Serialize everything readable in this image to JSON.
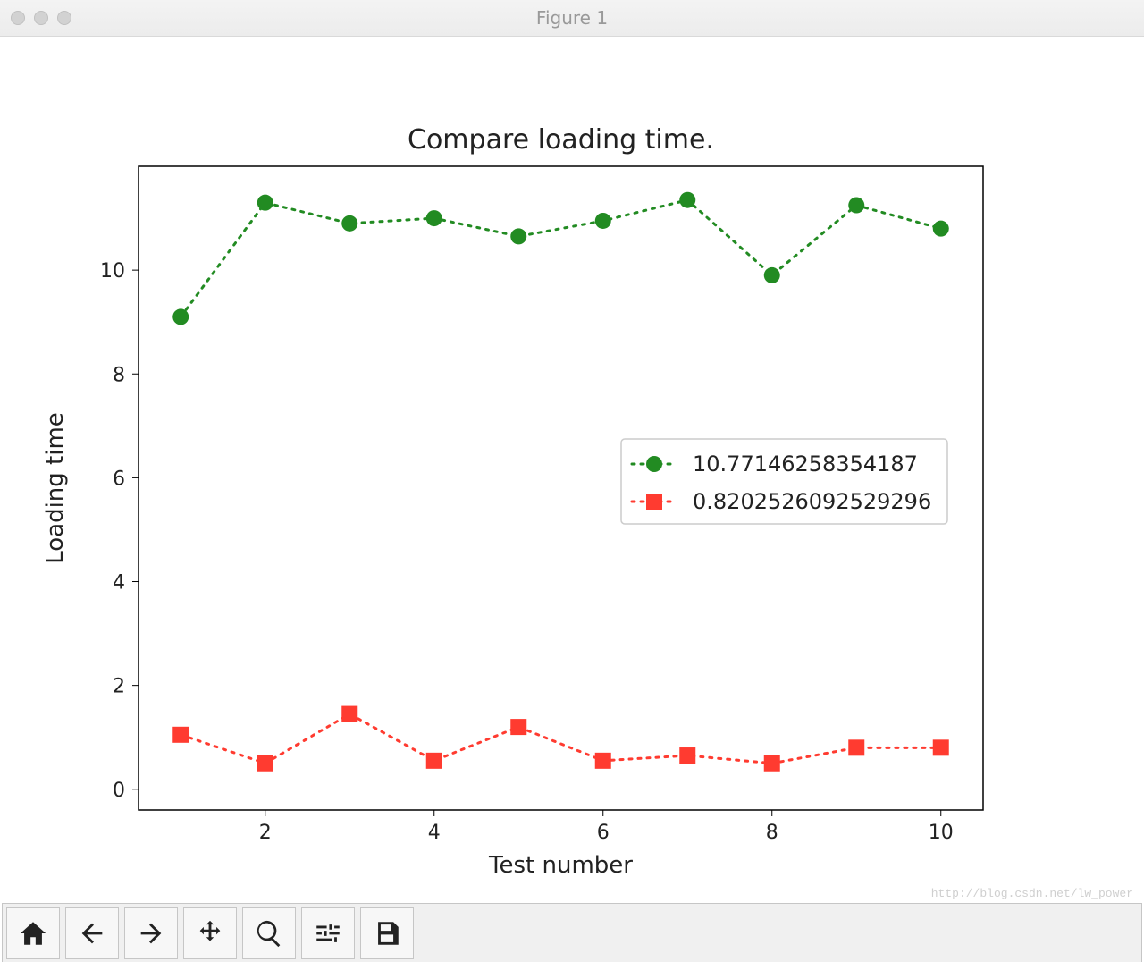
{
  "window": {
    "title": "Figure 1"
  },
  "watermark": "http://blog.csdn.net/lw_power",
  "toolbar": {
    "home": "Home",
    "back": "Back",
    "forward": "Forward",
    "pan": "Pan",
    "zoom": "Zoom",
    "subplots": "Configure subplots",
    "save": "Save"
  },
  "chart_data": {
    "type": "line",
    "title": "Compare loading time.",
    "xlabel": "Test number",
    "ylabel": "Loading time",
    "x": [
      1,
      2,
      3,
      4,
      5,
      6,
      7,
      8,
      9,
      10
    ],
    "xticks": [
      2,
      4,
      6,
      8,
      10
    ],
    "yticks": [
      0,
      2,
      4,
      6,
      8,
      10
    ],
    "xlim": [
      0.5,
      10.5
    ],
    "ylim": [
      -0.4,
      12.0
    ],
    "legend_position": "center-right",
    "series": [
      {
        "name": "10.77146258354187",
        "color": "#228B22",
        "linestyle": "dotted",
        "marker": "circle",
        "values": [
          9.1,
          11.3,
          10.9,
          11.0,
          10.65,
          10.95,
          11.35,
          9.9,
          11.25,
          10.8
        ]
      },
      {
        "name": "0.8202526092529296",
        "color": "#ff3b30",
        "linestyle": "dotted",
        "marker": "square",
        "values": [
          1.05,
          0.5,
          1.45,
          0.55,
          1.2,
          0.55,
          0.65,
          0.5,
          0.8,
          0.8
        ]
      }
    ]
  }
}
